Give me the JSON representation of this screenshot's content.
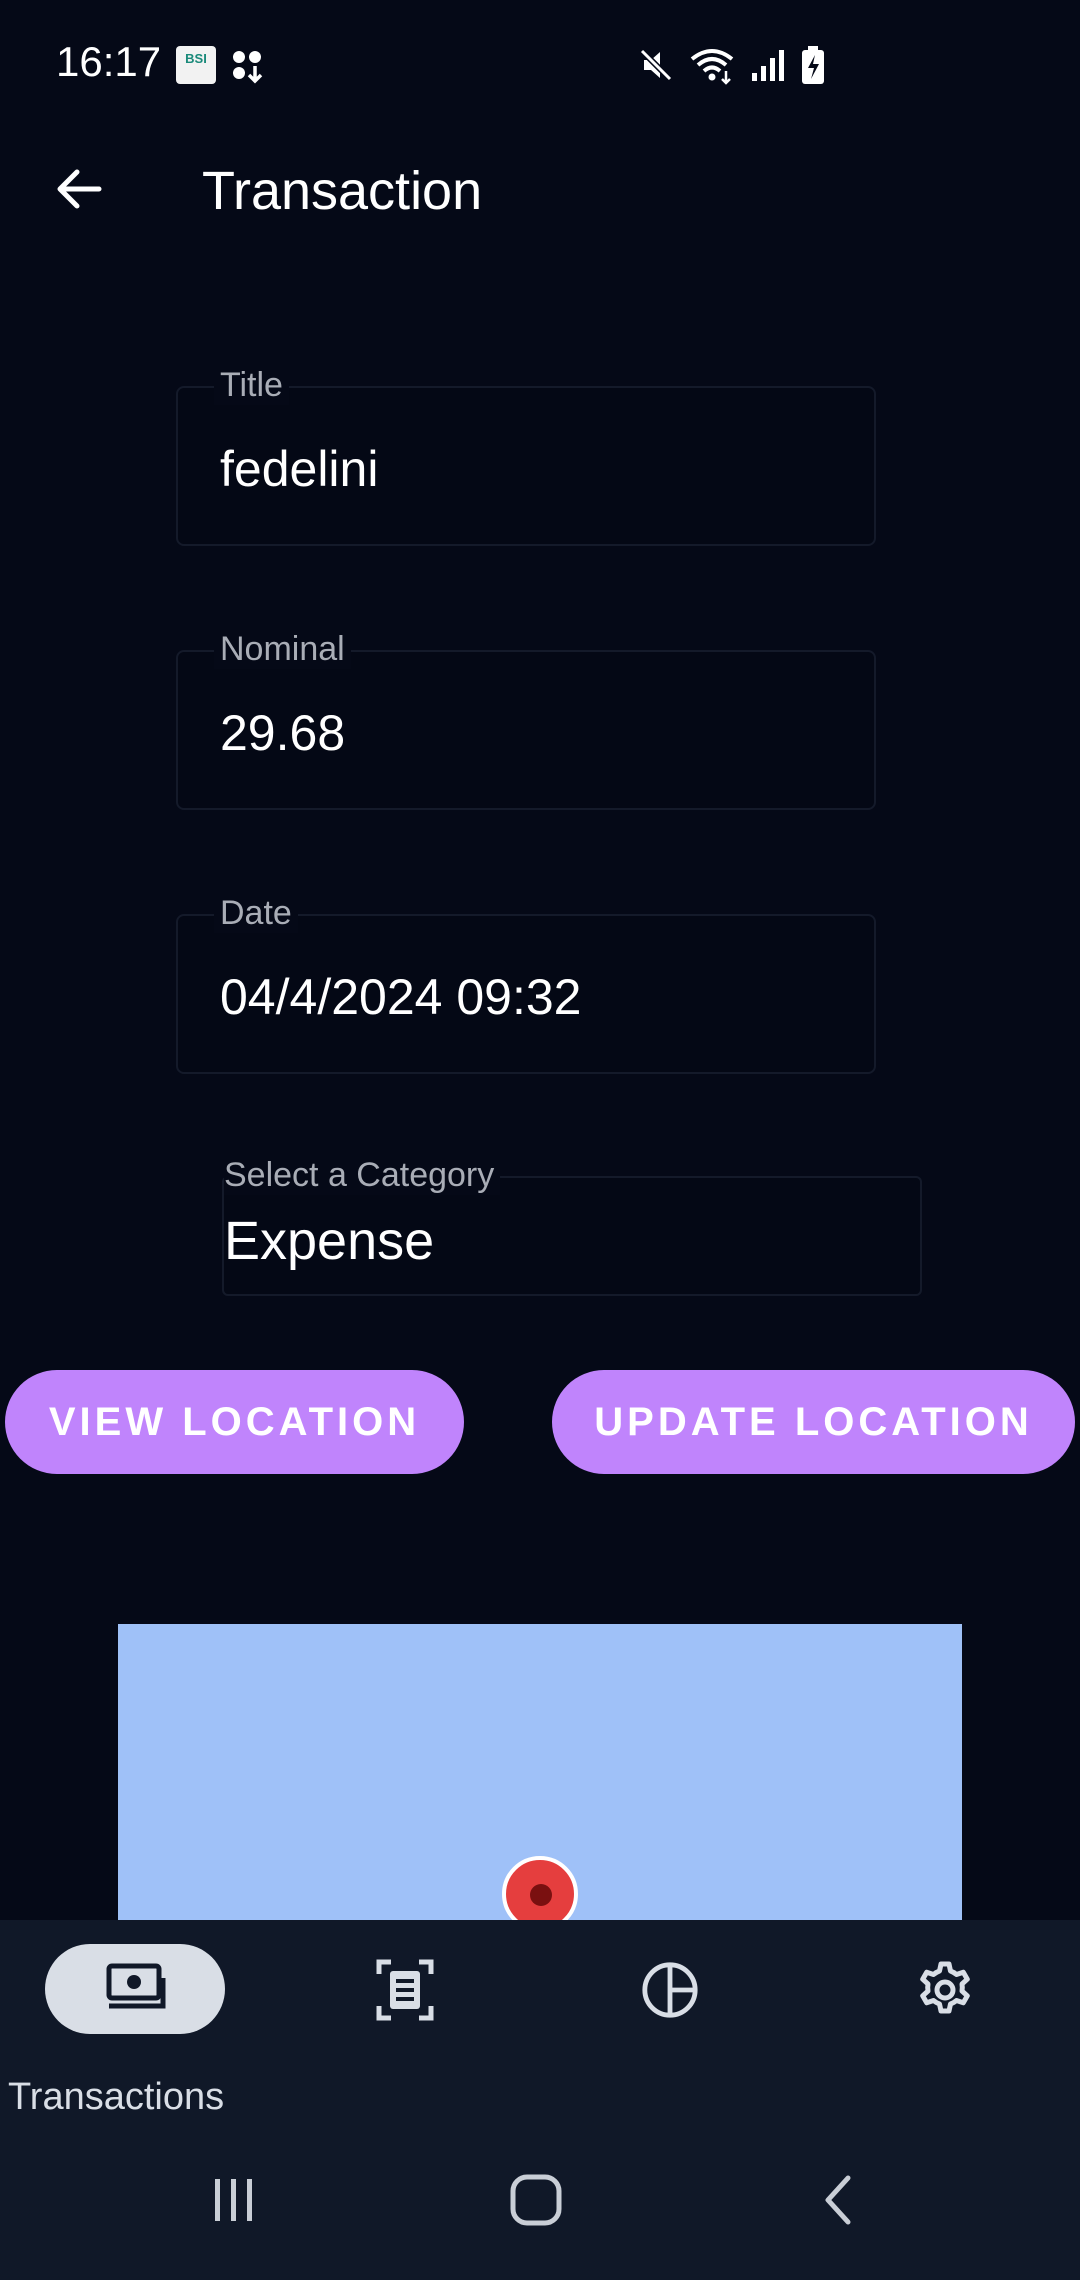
{
  "status_bar": {
    "time": "16:17",
    "app_icon_text": "BSI",
    "icons": [
      "notification-grid-icon",
      "mute-icon",
      "wifi-icon",
      "signal-icon",
      "battery-charging-icon"
    ]
  },
  "header": {
    "title": "Transaction",
    "back_icon": "arrow-left-icon"
  },
  "form": {
    "title_label": "Title",
    "title_value": "fedelini",
    "nominal_label": "Nominal",
    "nominal_value": "29.68",
    "date_label": "Date",
    "date_value": "04/4/2024 09:32",
    "category_label": "Select a Category",
    "category_value": "Expense"
  },
  "buttons": {
    "view_location": "VIEW LOCATION",
    "update_location": "UPDATE LOCATION"
  },
  "colors": {
    "background": "#050917",
    "accent": "#c084fc",
    "map_water": "#9fc1f8",
    "pin": "#e53e3e",
    "nav_background": "#101828"
  },
  "bottom_nav": {
    "items": [
      {
        "label": "Transactions",
        "icon": "cash-stack-icon",
        "active": true
      },
      {
        "label": "",
        "icon": "receipt-scan-icon",
        "active": false
      },
      {
        "label": "",
        "icon": "pie-chart-icon",
        "active": false
      },
      {
        "label": "",
        "icon": "gear-icon",
        "active": false
      }
    ]
  },
  "system_nav": {
    "icons": [
      "recents-icon",
      "home-icon",
      "system-back-icon"
    ]
  }
}
